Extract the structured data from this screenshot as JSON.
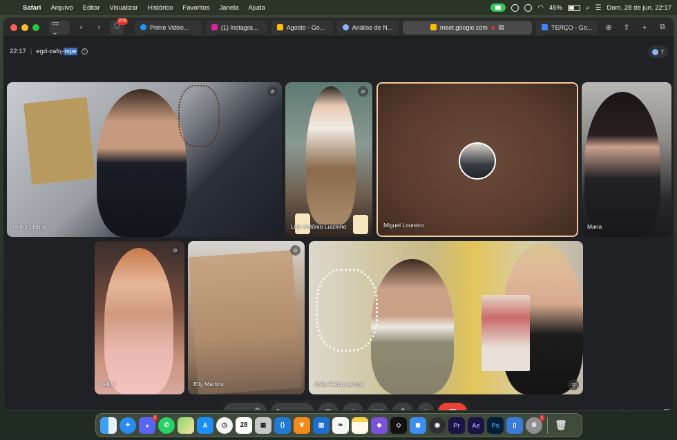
{
  "menubar": {
    "app": "Safari",
    "items": [
      "Arquivo",
      "Editar",
      "Visualizar",
      "Histórico",
      "Favoritos",
      "Janela",
      "Ajuda"
    ],
    "battery": "45%",
    "datetime": "Dom. 28 de jun.  22:17"
  },
  "browser": {
    "shield_badge": "278",
    "tabs": [
      {
        "label": "Prime Video...",
        "color": "#1a98ff"
      },
      {
        "label": "(1) Instagra...",
        "color": "#d6249f"
      },
      {
        "label": "Agosto - Go...",
        "color": "#fbbc04"
      },
      {
        "label": "Análise de N...",
        "color": "#8ab4f8"
      },
      {
        "label": "meet.google.com",
        "color": "#fbbc04"
      },
      {
        "label": "TERÇO - Go...",
        "color": "#4285f4"
      }
    ]
  },
  "meet": {
    "time": "22:17",
    "code_prefix": "egd-zafq-",
    "code_selected": "wpe",
    "participants_count": "7",
    "tiles": [
      {
        "name": "Heitor Lisboa"
      },
      {
        "name": "Luiz Antônio Luizinho"
      },
      {
        "name": "Miguel Loureiro"
      },
      {
        "name": "Maria"
      },
      {
        "name": "hello !"
      },
      {
        "name": "Elly Martins"
      },
      {
        "name": "João Pedro Lemos"
      }
    ]
  },
  "dock": {
    "calendar_day": "28",
    "discord_badge": "2",
    "last_badge": "1"
  }
}
